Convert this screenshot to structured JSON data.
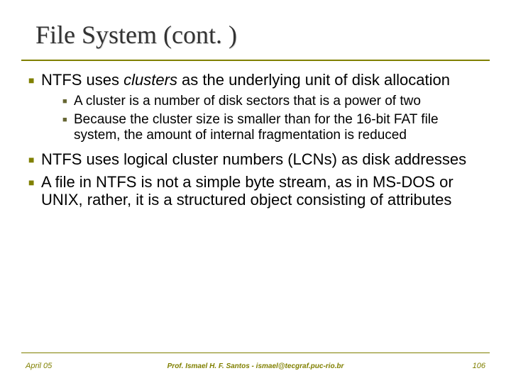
{
  "title": "File System (cont. )",
  "bullets": {
    "b1": {
      "pre": "NTFS uses ",
      "em": "clusters",
      "post": " as the underlying unit of disk allocation",
      "sub": {
        "s1": "A cluster is a number of disk sectors that is a power of two",
        "s2": "Because the cluster size is smaller than for the 16-bit FAT file system, the amount of internal fragmentation is reduced"
      }
    },
    "b2": "NTFS uses logical cluster numbers (LCNs) as disk addresses",
    "b3": "A file in NTFS is not a simple byte stream, as in MS-DOS or UNIX, rather, it is a structured object consisting of attributes"
  },
  "footer": {
    "left": "April 05",
    "center": "Prof. Ismael H. F. Santos - ismael@tecgraf.puc-rio.br",
    "right": "106"
  },
  "glyphs": {
    "square": "■"
  }
}
